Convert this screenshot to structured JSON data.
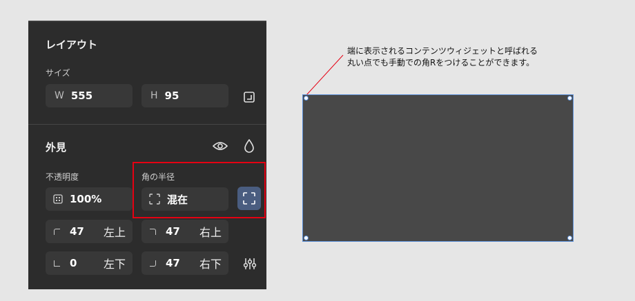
{
  "layout_section": {
    "title": "レイアウト",
    "size_label": "サイズ",
    "width": {
      "prefix": "W",
      "value": "555"
    },
    "height": {
      "prefix": "H",
      "value": "95"
    },
    "resize_icon": "resize-to-fit-icon"
  },
  "appearance_section": {
    "title": "外見",
    "visibility_icon": "eye-icon",
    "fill_icon": "drop-icon",
    "opacity_label": "不透明度",
    "opacity_value": "100%",
    "radius_label": "角の半径",
    "radius_value": "混在",
    "independent_corners_icon": "independent-corners-icon",
    "corners": {
      "top_left": {
        "value": "47",
        "label": "左上"
      },
      "top_right": {
        "value": "47",
        "label": "右上"
      },
      "bottom_left": {
        "value": "0",
        "label": "左下"
      },
      "bottom_right": {
        "value": "47",
        "label": "右下"
      }
    },
    "adjust_icon": "sliders-icon"
  },
  "canvas": {
    "annotation_line1": "端に表示されるコンテンツウィジェットと呼ばれる",
    "annotation_line2": "丸い点でも手動での角Rをつけることができます。"
  },
  "colors": {
    "panel_bg": "#2c2c2c",
    "field_bg": "#383838",
    "highlight": "#e60012",
    "selection": "#5b8fd8",
    "active_button": "#4a5d80"
  }
}
